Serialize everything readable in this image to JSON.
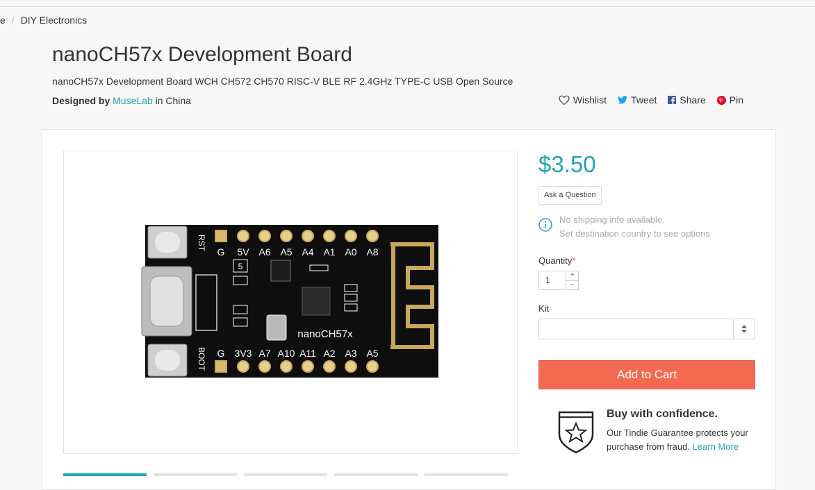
{
  "breadcrumb": {
    "home": "e",
    "category": "DIY Electronics"
  },
  "product": {
    "title": "nanoCH57x Development Board",
    "subtitle": "nanoCH57x Development Board WCH CH572 CH570 RISC-V BLE RF 2.4GHz TYPE-C USB Open Source",
    "designed_by_label": "Designed by",
    "designer": "MuseLab",
    "location": "in China",
    "price": "$3.50"
  },
  "social": {
    "wishlist": "Wishlist",
    "tweet": "Tweet",
    "share": "Share",
    "pin": "Pin"
  },
  "board": {
    "top_pins": [
      "G",
      "5V",
      "A6",
      "A5",
      "A4",
      "A1",
      "A0",
      "A8"
    ],
    "bottom_pins": [
      "G",
      "3V3",
      "A7",
      "A10",
      "A11",
      "A2",
      "A3",
      "A5"
    ],
    "rst": "RST",
    "boot": "BOOT",
    "name": "nanoCH57x",
    "five": "5"
  },
  "ask_question": "Ask a Question",
  "shipping": {
    "line1": "No shipping info available.",
    "line2": "Set destination country to see options"
  },
  "quantity": {
    "label": "Quantity",
    "required": "*",
    "value": "1",
    "plus": "+",
    "minus": "−"
  },
  "kit": {
    "label": "Kit",
    "value": ""
  },
  "add_to_cart": "Add to Cart",
  "confidence": {
    "title": "Buy with confidence.",
    "text": "Our Tindie Guarantee protects your purchase from fraud.",
    "link": "Learn More"
  },
  "colors": {
    "accent": "#21a4b6",
    "cart": "#f26a52"
  }
}
